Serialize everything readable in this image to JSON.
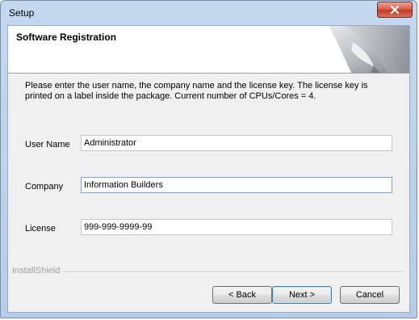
{
  "window": {
    "title": "Setup"
  },
  "header": {
    "title": "Software Registration"
  },
  "instructions": "Please enter the user name, the company name and the license key. The license key is printed on a label inside the package. Current number of CPUs/Cores = 4.",
  "form": {
    "user_name": {
      "label": "User Name",
      "value": "Administrator"
    },
    "company": {
      "label": "Company",
      "value": "Information Builders"
    },
    "license": {
      "label": "License",
      "value": "999-999-9999-99"
    }
  },
  "footer": {
    "brand": "InstallShield"
  },
  "buttons": {
    "back": "< Back",
    "next": "Next >",
    "cancel": "Cancel"
  },
  "icons": {
    "close": "close-icon",
    "header_graphic": "page-curl-graphic"
  },
  "colors": {
    "close_button": "#c23a25",
    "default_button_border": "#3c7fb1",
    "window_frame": "#c4d9ef"
  }
}
